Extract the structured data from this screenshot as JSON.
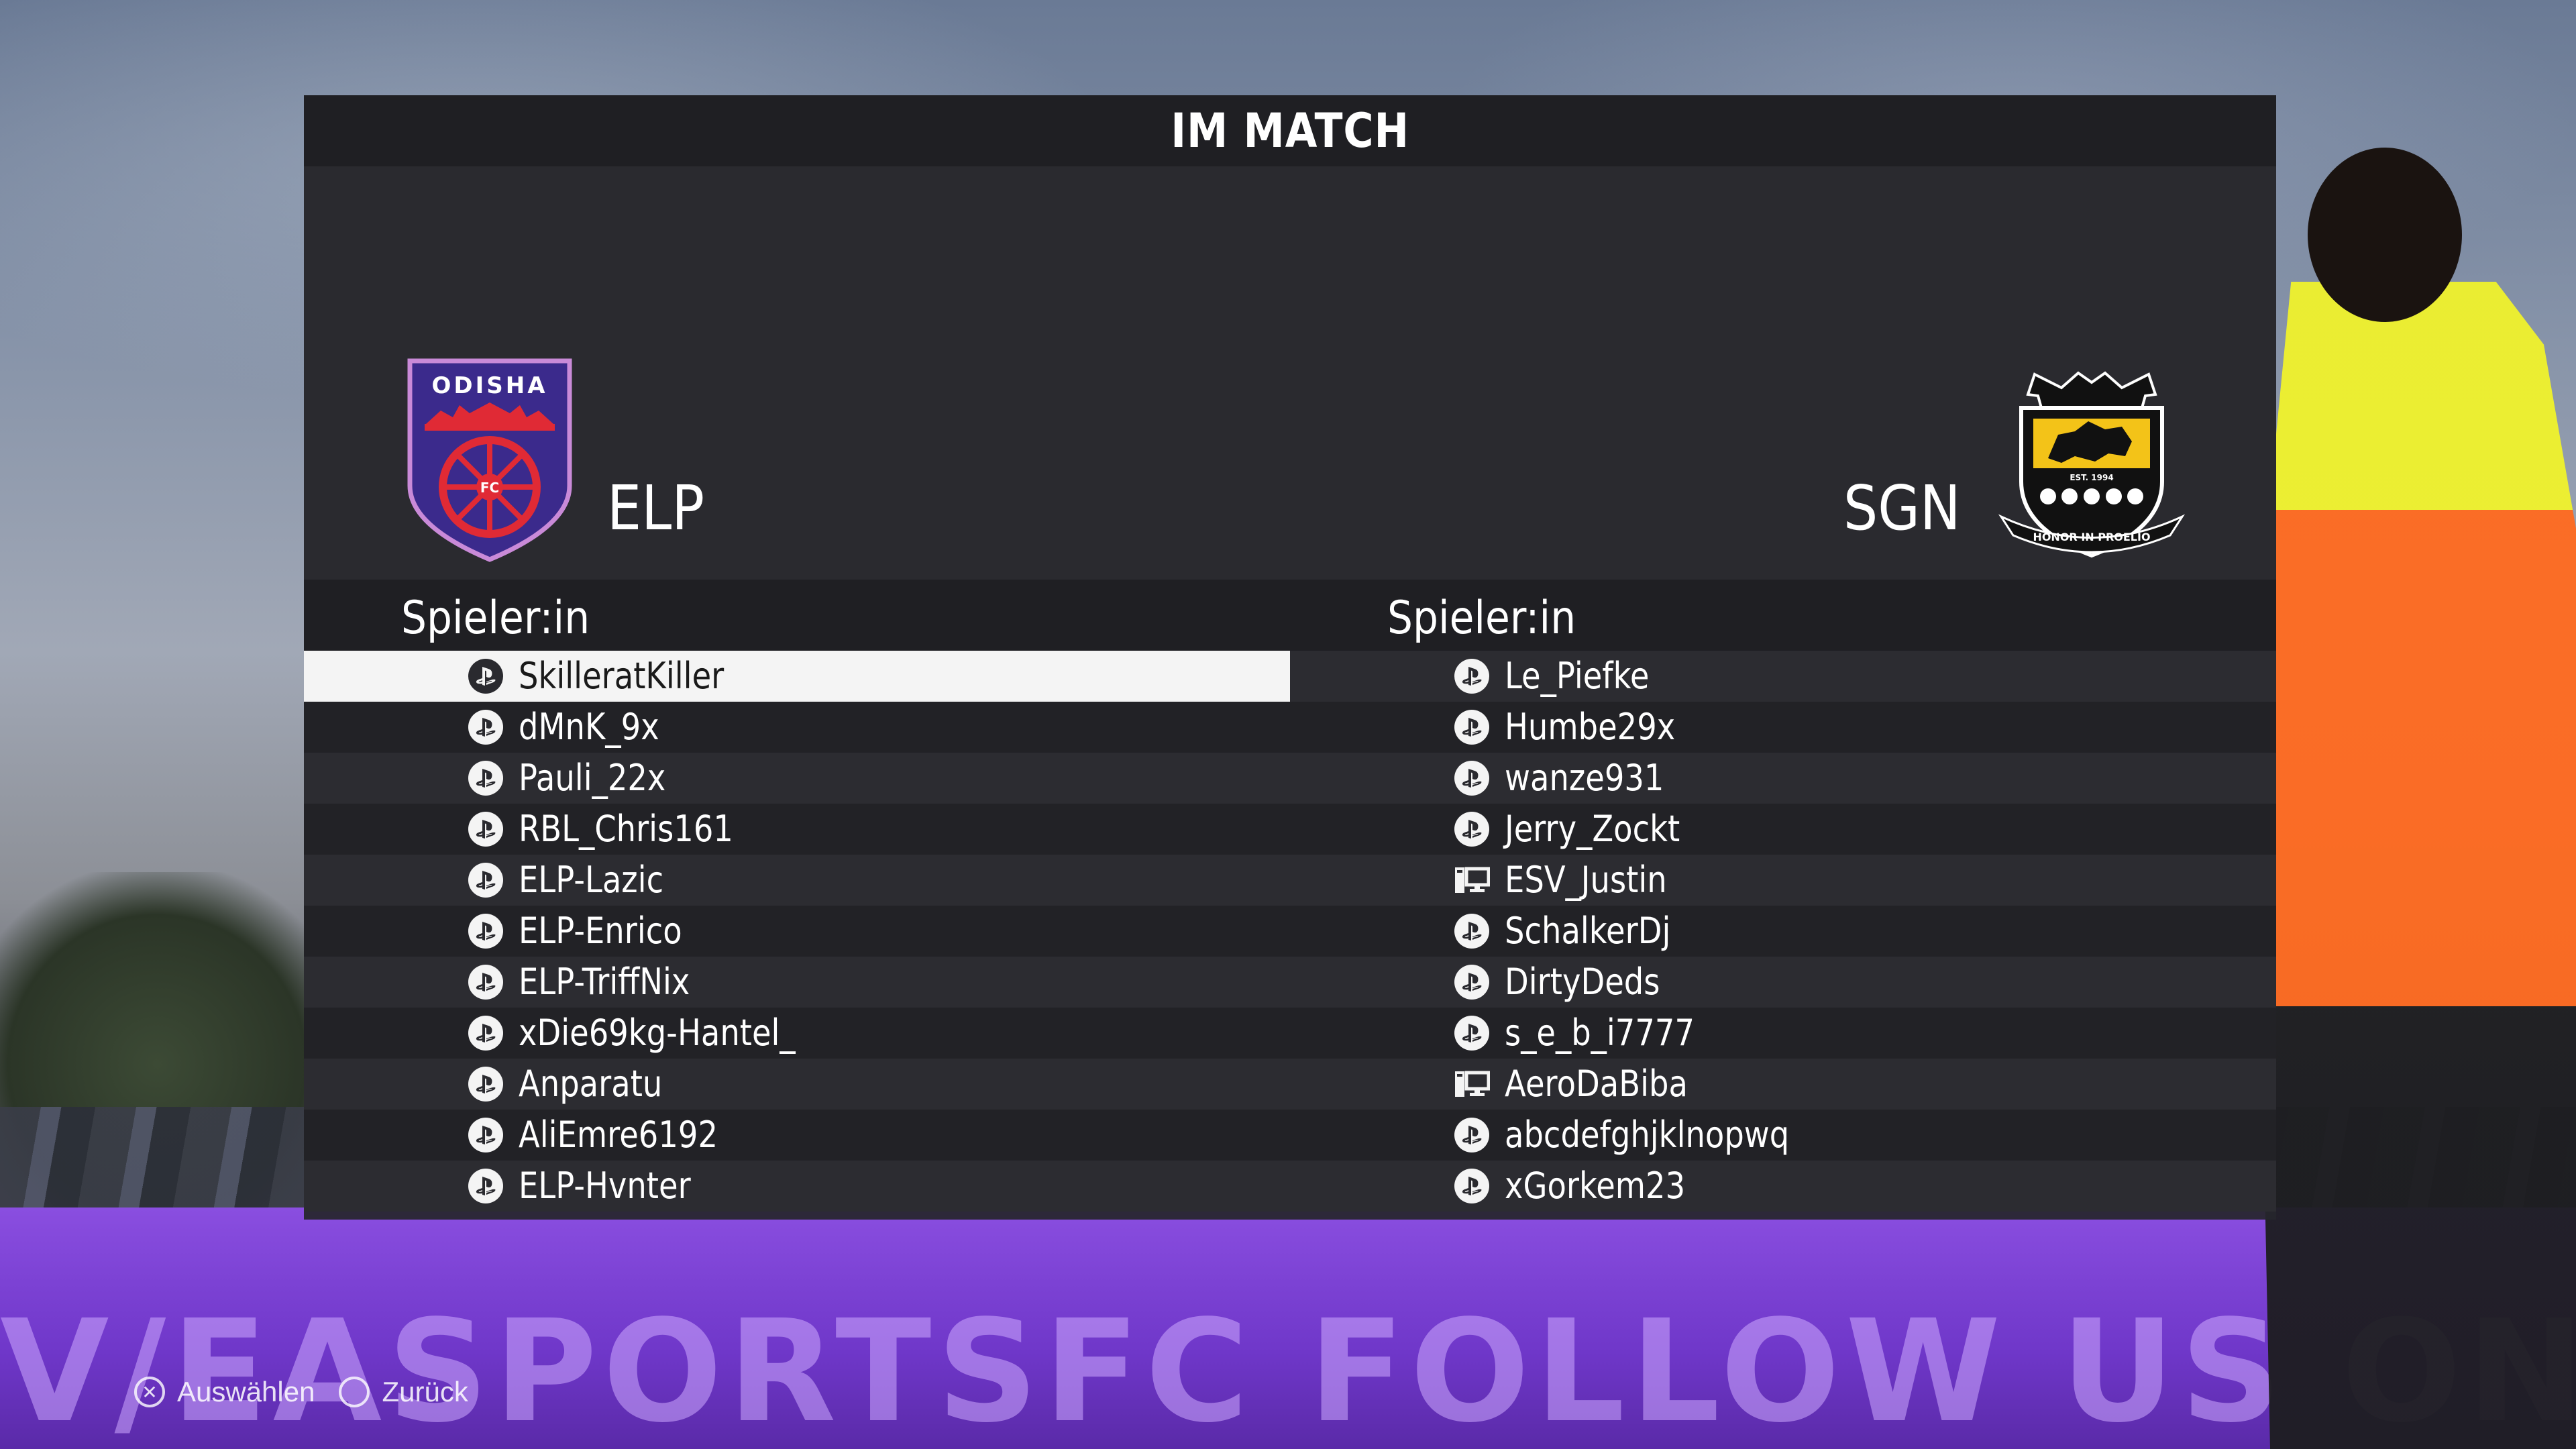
{
  "screen": {
    "title": "IM MATCH"
  },
  "home_team": {
    "abbr": "ELP",
    "crest_text": "ODISHA",
    "crest_sub": "FC",
    "players_header": "Spieler:in",
    "players": [
      {
        "name": "SkilleratKiller",
        "platform": "playstation-icon",
        "selected": true
      },
      {
        "name": "dMnK_9x",
        "platform": "playstation-icon"
      },
      {
        "name": "Pauli_22x",
        "platform": "playstation-icon"
      },
      {
        "name": "RBL_Chris161",
        "platform": "playstation-icon"
      },
      {
        "name": "ELP-Lazic",
        "platform": "playstation-icon"
      },
      {
        "name": "ELP-Enrico",
        "platform": "playstation-icon"
      },
      {
        "name": "ELP-TriffNix",
        "platform": "playstation-icon"
      },
      {
        "name": "xDie69kg-Hantel_",
        "platform": "playstation-icon"
      },
      {
        "name": "Anparatu",
        "platform": "playstation-icon"
      },
      {
        "name": "AliEmre6192",
        "platform": "playstation-icon"
      },
      {
        "name": "ELP-Hvnter",
        "platform": "playstation-icon"
      }
    ]
  },
  "away_team": {
    "abbr": "SGN",
    "crest_est": "EST. 1994",
    "crest_motto": "HONOR IN PROELIO",
    "players_header": "Spieler:in",
    "players": [
      {
        "name": "Le_Piefke",
        "platform": "playstation-icon"
      },
      {
        "name": "Humbe29x",
        "platform": "playstation-icon"
      },
      {
        "name": "wanze931",
        "platform": "playstation-icon"
      },
      {
        "name": "Jerry_Zockt",
        "platform": "playstation-icon"
      },
      {
        "name": "ESV_Justin",
        "platform": "pc-icon"
      },
      {
        "name": "SchalkerDj",
        "platform": "playstation-icon"
      },
      {
        "name": "DirtyDeds",
        "platform": "playstation-icon"
      },
      {
        "name": "s_e_b_i7777",
        "platform": "playstation-icon"
      },
      {
        "name": "AeroDaBiba",
        "platform": "pc-icon"
      },
      {
        "name": "abcdefghjklnopwq",
        "platform": "playstation-icon"
      },
      {
        "name": "xGorkem23",
        "platform": "playstation-icon"
      }
    ]
  },
  "hints": {
    "select_label": "Auswählen",
    "back_label": "Zurück"
  },
  "background": {
    "board_text": "V/EASPORTSFC    FOLLOW US ON    twitch"
  },
  "colors": {
    "selected_row": "#f4f4f4",
    "odisha_purple": "#3b2a8c",
    "odisha_red": "#e02a35",
    "board_purple": "#7a42d8"
  }
}
